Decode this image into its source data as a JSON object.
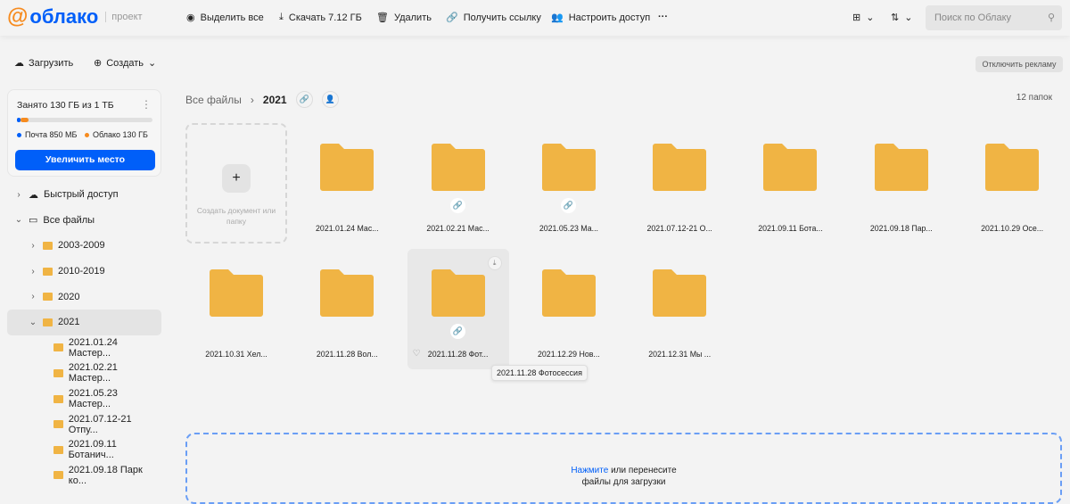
{
  "header": {
    "logo_at": "@",
    "logo_name": "облако",
    "logo_tag": "проект",
    "select_all": "Выделить все",
    "download": "Скачать 7.12 ГБ",
    "delete": "Удалить",
    "get_link": "Получить ссылку",
    "access": "Настроить доступ",
    "more": "···",
    "search_placeholder": "Поиск по Облаку"
  },
  "sidebar": {
    "upload": "Загрузить",
    "create": "Создать",
    "storage": {
      "title": "Занято 130 ГБ из 1 ТБ",
      "mail": "Почта 850 МБ",
      "cloud": "Облако 130 ГБ",
      "increase": "Увеличить место",
      "mail_fraction": 0.001,
      "cloud_fraction": 0.13
    },
    "tree": [
      {
        "label": "Быстрый доступ",
        "level": 0
      },
      {
        "label": "Все файлы",
        "level": 0
      },
      {
        "label": "2003-2009",
        "level": 1
      },
      {
        "label": "2010-2019",
        "level": 1
      },
      {
        "label": "2020",
        "level": 1
      },
      {
        "label": "2021",
        "level": 1
      },
      {
        "label": "2021.01.24 Мастер...",
        "level": 2
      },
      {
        "label": "2021.02.21 Мастер...",
        "level": 2
      },
      {
        "label": "2021.05.23 Мастер...",
        "level": 2
      },
      {
        "label": "2021.07.12-21 Отпу...",
        "level": 2
      },
      {
        "label": "2021.09.11 Ботанич...",
        "level": 2
      },
      {
        "label": "2021.09.18 Парк ко...",
        "level": 2
      }
    ]
  },
  "main": {
    "breadcrumb_root": "Все файлы",
    "breadcrumb_current": "2021",
    "ads_button": "Отключить рекламу",
    "count": "12 папок",
    "create_label": "Создать документ или папку",
    "folders": [
      {
        "name": "2021.01.24 Мас...",
        "link": false
      },
      {
        "name": "2021.02.21 Мас...",
        "link": true
      },
      {
        "name": "2021.05.23 Ма...",
        "link": true
      },
      {
        "name": "2021.07.12-21 О...",
        "link": false
      },
      {
        "name": "2021.09.11 Бота...",
        "link": false
      },
      {
        "name": "2021.09.18 Пар...",
        "link": false
      },
      {
        "name": "2021.10.29 Осе...",
        "link": false
      },
      {
        "name": "2021.10.31 Хел...",
        "link": false
      },
      {
        "name": "2021.11.28 Вол...",
        "link": false
      },
      {
        "name": "2021.11.28 Фот...",
        "link": true,
        "hover": true
      },
      {
        "name": "2021.12.29 Нов...",
        "link": false
      },
      {
        "name": "2021.12.31 Мы ...",
        "link": false
      }
    ],
    "tooltip": "2021.11.28 Фотосессия",
    "drop_link": "Нажмите",
    "drop_text": " или перенесите",
    "drop_text2": "файлы для загрузки"
  },
  "colors": {
    "accent": "#005ff9",
    "brand_orange": "#f68b1f",
    "folder": "#f0b444",
    "link_green": "#2ca24c"
  }
}
